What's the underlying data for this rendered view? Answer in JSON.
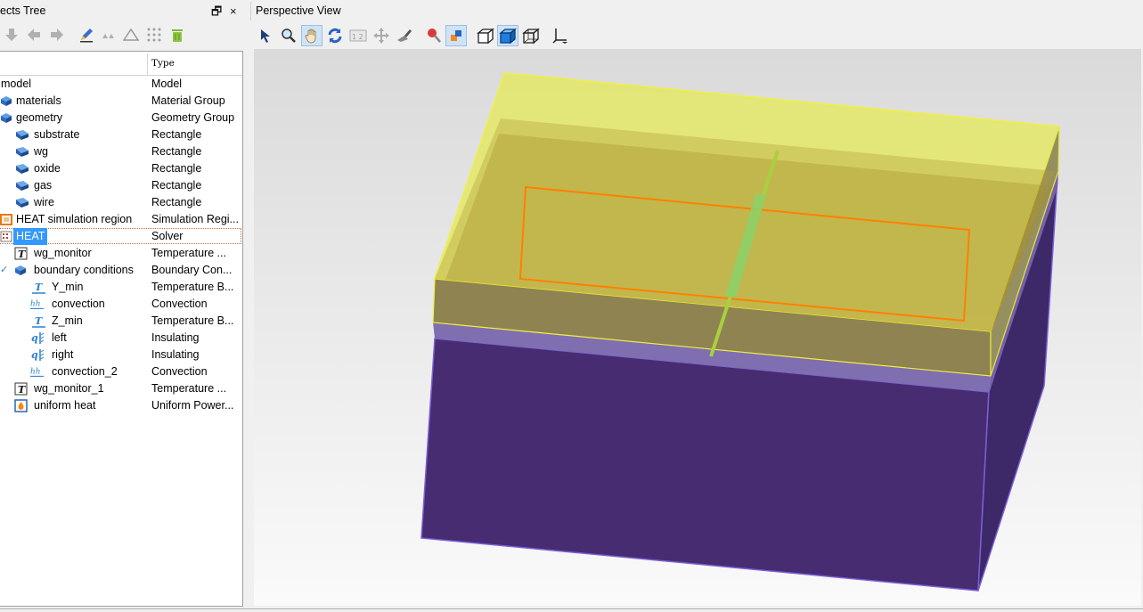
{
  "objects_tree": {
    "title": "ects Tree",
    "float_button": "🗗",
    "close_button": "×",
    "columns": {
      "type": "Type"
    },
    "rows": [
      {
        "name": "model",
        "type": "Model"
      },
      {
        "name": "materials",
        "type": "Material Group"
      },
      {
        "name": "geometry",
        "type": "Geometry Group"
      },
      {
        "name": "substrate",
        "type": "Rectangle"
      },
      {
        "name": "wg",
        "type": "Rectangle"
      },
      {
        "name": "oxide",
        "type": "Rectangle"
      },
      {
        "name": "gas",
        "type": "Rectangle"
      },
      {
        "name": "wire",
        "type": "Rectangle"
      },
      {
        "name": "HEAT simulation region",
        "type": "Simulation Regi..."
      },
      {
        "name": "HEAT",
        "type": "Solver"
      },
      {
        "name": "wg_monitor",
        "type": "Temperature ..."
      },
      {
        "name": "boundary conditions",
        "type": "Boundary Con..."
      },
      {
        "name": "Y_min",
        "type": "Temperature B..."
      },
      {
        "name": "convection",
        "type": "Convection"
      },
      {
        "name": "Z_min",
        "type": "Temperature B..."
      },
      {
        "name": "left",
        "type": "Insulating"
      },
      {
        "name": "right",
        "type": "Insulating"
      },
      {
        "name": "convection_2",
        "type": "Convection"
      },
      {
        "name": "wg_monitor_1",
        "type": "Temperature ..."
      },
      {
        "name": "uniform heat",
        "type": "Uniform Power..."
      }
    ]
  },
  "perspective_view": {
    "title": "Perspective View"
  },
  "colors": {
    "substrate": "#472c72",
    "oxide_top": "#e6ea6a",
    "selection": "#3399ff",
    "region_outline": "#ff8000"
  }
}
